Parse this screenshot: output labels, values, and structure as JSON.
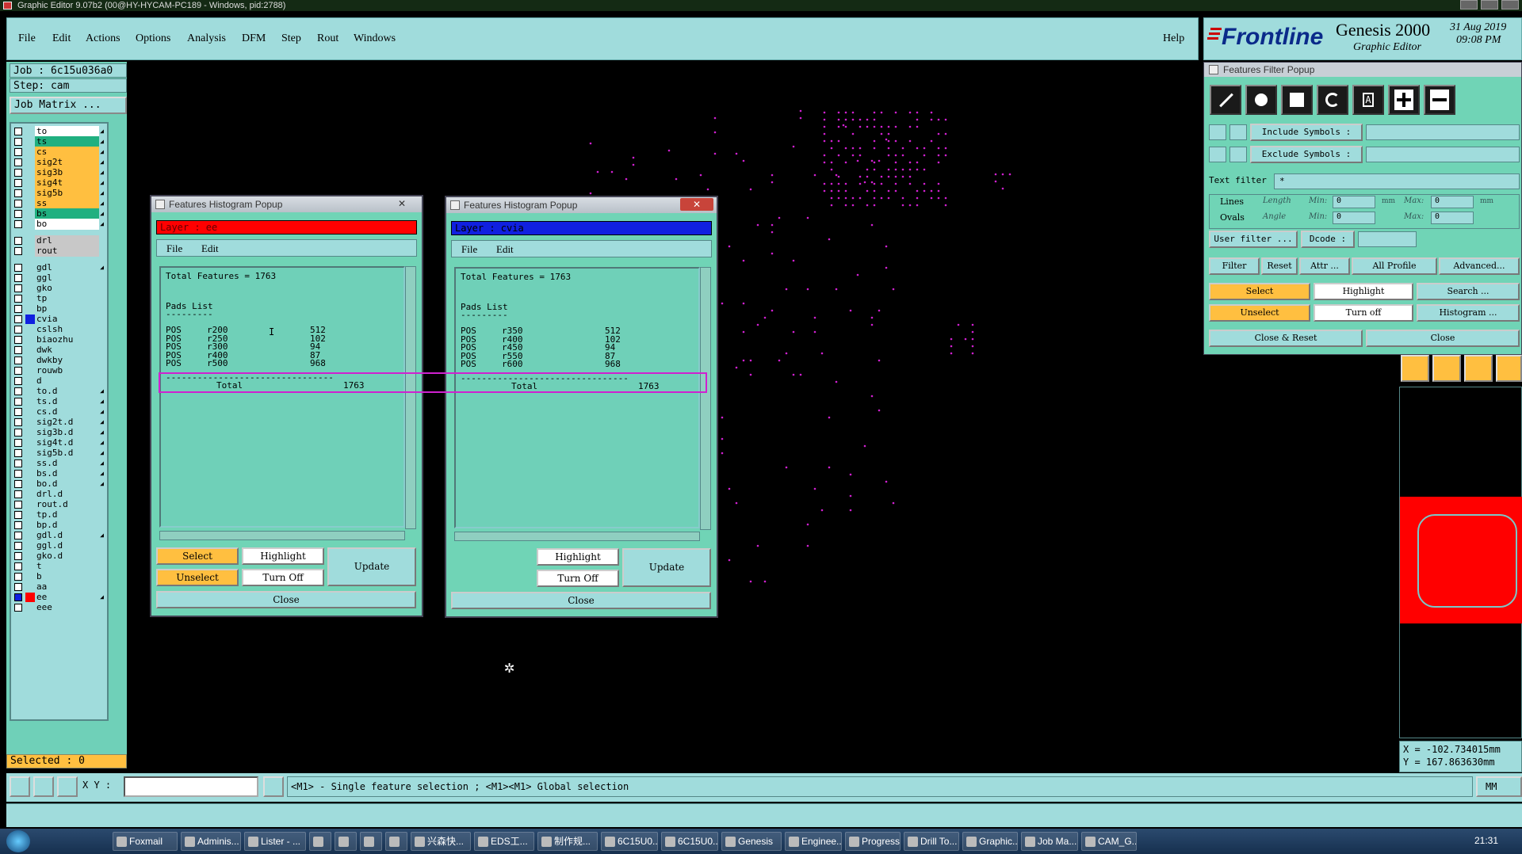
{
  "window": {
    "title": "Graphic Editor 9.07b2 (00@HY-HYCAM-PC189 - Windows, pid:2788)"
  },
  "menubar": {
    "items": [
      "File",
      "Edit",
      "Actions",
      "Options",
      "Analysis",
      "DFM",
      "Step",
      "Rout",
      "Windows"
    ],
    "help": "Help"
  },
  "logo": {
    "brand": "Frontline",
    "product": "Genesis 2000",
    "subtitle": "Graphic Editor",
    "date": "31 Aug 2019",
    "time": "09:08 PM"
  },
  "left": {
    "job": "Job : 6c15u036a0",
    "step": "Step: cam",
    "job_matrix": "Job Matrix ...",
    "selected": "Selected : 0",
    "layers": [
      {
        "name": "to",
        "bg": "#ffffff",
        "arrow": true
      },
      {
        "name": "ts",
        "bg": "#20b080",
        "arrow": true
      },
      {
        "name": "cs",
        "bg": "#ffbf40",
        "arrow": true
      },
      {
        "name": "sig2t",
        "bg": "#ffbf40",
        "arrow": true
      },
      {
        "name": "sig3b",
        "bg": "#ffbf40",
        "arrow": true
      },
      {
        "name": "sig4t",
        "bg": "#ffbf40",
        "arrow": true
      },
      {
        "name": "sig5b",
        "bg": "#ffbf40",
        "arrow": true
      },
      {
        "name": "ss",
        "bg": "#ffbf40",
        "arrow": true
      },
      {
        "name": "bs",
        "bg": "#20b080",
        "arrow": true
      },
      {
        "name": "bo",
        "bg": "#ffffff",
        "arrow": true
      },
      {
        "name": "drl",
        "bg": "#c8c8c8",
        "arrow": false
      },
      {
        "name": "rout",
        "bg": "#c8c8c8",
        "arrow": false
      },
      {
        "name": "gdl",
        "bg": "#a0dcdc",
        "arrow": true
      },
      {
        "name": "ggl",
        "bg": "#a0dcdc",
        "arrow": false
      },
      {
        "name": "gko",
        "bg": "#a0dcdc",
        "arrow": false
      },
      {
        "name": "tp",
        "bg": "#a0dcdc",
        "arrow": false
      },
      {
        "name": "bp",
        "bg": "#a0dcdc",
        "arrow": false
      },
      {
        "name": "cvia",
        "bg": "#a0dcdc",
        "arrow": false,
        "swatch": "#1020e0"
      },
      {
        "name": "cslsh",
        "bg": "#a0dcdc",
        "arrow": false
      },
      {
        "name": "biaozhu",
        "bg": "#a0dcdc",
        "arrow": false
      },
      {
        "name": "dwk",
        "bg": "#a0dcdc",
        "arrow": false
      },
      {
        "name": "dwkby",
        "bg": "#a0dcdc",
        "arrow": false
      },
      {
        "name": "rouwb",
        "bg": "#a0dcdc",
        "arrow": false
      },
      {
        "name": "d",
        "bg": "#a0dcdc",
        "arrow": false
      },
      {
        "name": "to.d",
        "bg": "#a0dcdc",
        "arrow": true
      },
      {
        "name": "ts.d",
        "bg": "#a0dcdc",
        "arrow": true
      },
      {
        "name": "cs.d",
        "bg": "#a0dcdc",
        "arrow": true
      },
      {
        "name": "sig2t.d",
        "bg": "#a0dcdc",
        "arrow": true
      },
      {
        "name": "sig3b.d",
        "bg": "#a0dcdc",
        "arrow": true
      },
      {
        "name": "sig4t.d",
        "bg": "#a0dcdc",
        "arrow": true
      },
      {
        "name": "sig5b.d",
        "bg": "#a0dcdc",
        "arrow": true
      },
      {
        "name": "ss.d",
        "bg": "#a0dcdc",
        "arrow": true
      },
      {
        "name": "bs.d",
        "bg": "#a0dcdc",
        "arrow": true
      },
      {
        "name": "bo.d",
        "bg": "#a0dcdc",
        "arrow": true
      },
      {
        "name": "drl.d",
        "bg": "#a0dcdc",
        "arrow": false
      },
      {
        "name": "rout.d",
        "bg": "#a0dcdc",
        "arrow": false
      },
      {
        "name": "tp.d",
        "bg": "#a0dcdc",
        "arrow": false
      },
      {
        "name": "bp.d",
        "bg": "#a0dcdc",
        "arrow": false
      },
      {
        "name": "gdl.d",
        "bg": "#a0dcdc",
        "arrow": true
      },
      {
        "name": "ggl.d",
        "bg": "#a0dcdc",
        "arrow": false
      },
      {
        "name": "gko.d",
        "bg": "#a0dcdc",
        "arrow": false
      },
      {
        "name": "t",
        "bg": "#a0dcdc",
        "arrow": false
      },
      {
        "name": "b",
        "bg": "#a0dcdc",
        "arrow": false
      },
      {
        "name": "aa",
        "bg": "#a0dcdc",
        "arrow": false
      },
      {
        "name": "ee",
        "bg": "#a0dcdc",
        "arrow": true,
        "swatch": "#ff0000",
        "active": true
      },
      {
        "name": "eee",
        "bg": "#a0dcdc",
        "arrow": false
      }
    ]
  },
  "hist1": {
    "title": "Features Histogram Popup",
    "close": "✕",
    "layer_text": "Layer : ee",
    "layer_color": "#ff0000",
    "menu": [
      "File",
      "Edit"
    ],
    "total": "Total Features = 1763",
    "pads_heading": "Pads List",
    "rule": "---------",
    "rows": [
      [
        "POS",
        "r200",
        "512"
      ],
      [
        "POS",
        "r250",
        "102"
      ],
      [
        "POS",
        "r300",
        "94"
      ],
      [
        "POS",
        "r400",
        "87"
      ],
      [
        "POS",
        "r500",
        "968"
      ]
    ],
    "separator": "--------------------------------",
    "total_label": "Total",
    "total_value": "1763",
    "buttons": {
      "select": "Select",
      "highlight": "Highlight",
      "unselect": "Unselect",
      "turn_off": "Turn Off",
      "update": "Update",
      "close": "Close"
    }
  },
  "hist2": {
    "title": "Features Histogram Popup",
    "close": "✕",
    "layer_text": "Layer : cvia",
    "layer_color": "#1020e0",
    "menu": [
      "File",
      "Edit"
    ],
    "total": "Total Features = 1763",
    "pads_heading": "Pads List",
    "rule": "---------",
    "rows": [
      [
        "POS",
        "r350",
        "512"
      ],
      [
        "POS",
        "r400",
        "102"
      ],
      [
        "POS",
        "r450",
        "94"
      ],
      [
        "POS",
        "r550",
        "87"
      ],
      [
        "POS",
        "r600",
        "968"
      ]
    ],
    "separator": "--------------------------------",
    "total_label": "Total",
    "total_value": "1763",
    "buttons": {
      "highlight": "Highlight",
      "turn_off": "Turn Off",
      "update": "Update",
      "close": "Close"
    }
  },
  "filter": {
    "title": "Features Filter Popup",
    "include_symbols": "Include Symbols :",
    "exclude_symbols": "Exclude Symbols :",
    "text_filter": "Text filter",
    "text_filter_value": "*",
    "lines": "Lines",
    "ovals": "Ovals",
    "length": "Length",
    "angle": "Angle",
    "min": "Min:",
    "max": "Max:",
    "min_val": "0",
    "max_val": "0",
    "unit": "mm",
    "user_filter": "User filter ...",
    "dcode": "Dcode :",
    "filter": "Filter",
    "reset": "Reset",
    "attr": "Attr ...",
    "all_profile": "All Profile",
    "advanced": "Advanced...",
    "select": "Select",
    "highlight": "Highlight",
    "search": "Search ...",
    "unselect": "Unselect",
    "turn_off": "Turn off",
    "histogram": "Histogram ...",
    "close_reset": "Close & Reset",
    "close": "Close"
  },
  "coords": {
    "x": "X = -102.734015mm",
    "y": "Y = 167.863630mm"
  },
  "bottom": {
    "xy_label": "X Y :",
    "hint": "<M1> - Single feature selection ; <M1><M1> Global selection",
    "units": "MM"
  },
  "taskbar": {
    "items": [
      "Foxmail",
      "Adminis...",
      "Lister - ...",
      "",
      "",
      "",
      "",
      "兴森快...",
      "EDS工...",
      "制作规...",
      "6C15U0...",
      "6C15U0...",
      "Genesis",
      "Enginee...",
      "Progress",
      "Drill To...",
      "Graphic...",
      "Job Ma...",
      "CAM_G..."
    ],
    "clock": "21:31"
  },
  "colors": {
    "panel": "#a0dcdc",
    "popup": "#70d4b6",
    "pad": "#d020d0",
    "yellow": "#ffbf40"
  }
}
